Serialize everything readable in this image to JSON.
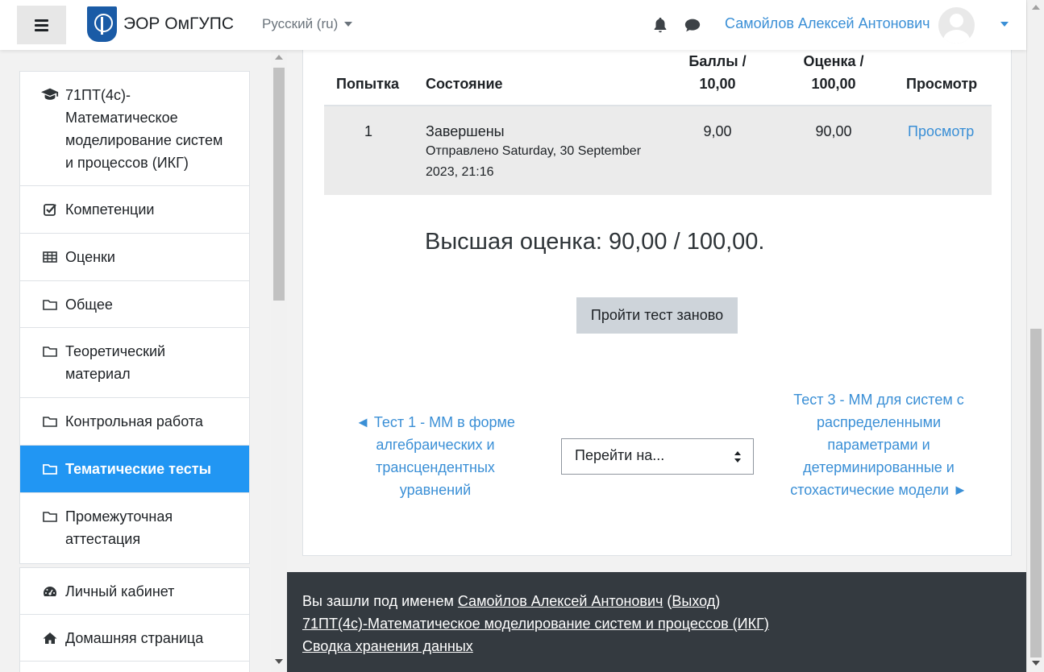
{
  "navbar": {
    "brand": "ЭОР ОмГУПС",
    "language": "Русский (ru)",
    "user_name": "Самойлов Алексей Антонович"
  },
  "drawer": {
    "course": "71ПТ(4с)-Математическое моделирование систем и процессов (ИКГ)",
    "items": [
      {
        "label": "Компетенции",
        "icon": "checkbox-icon"
      },
      {
        "label": "Оценки",
        "icon": "table-icon"
      },
      {
        "label": "Общее",
        "icon": "folder-icon"
      },
      {
        "label": "Теоретический материал",
        "icon": "folder-icon"
      },
      {
        "label": "Контрольная работа",
        "icon": "folder-icon"
      },
      {
        "label": "Тематические тесты",
        "icon": "folder-icon",
        "active": true
      },
      {
        "label": "Промежуточная аттестация",
        "icon": "folder-icon"
      }
    ],
    "secondary": [
      {
        "label": "Личный кабинет",
        "icon": "dashboard-icon"
      },
      {
        "label": "Домашняя страница",
        "icon": "home-icon"
      }
    ]
  },
  "attempts": {
    "headers": {
      "attempt": "Попытка",
      "state": "Состояние",
      "marks": "Баллы / 10,00",
      "grade": "Оценка / 100,00",
      "review": "Просмотр"
    },
    "rows": [
      {
        "attempt": "1",
        "state": "Завершены",
        "submitted": "Отправлено Saturday, 30 September 2023, 21:16",
        "marks": "9,00",
        "grade": "90,00",
        "review": "Просмотр"
      }
    ]
  },
  "summary": {
    "best_grade": "Высшая оценка: 90,00 / 100,00.",
    "retake_button": "Пройти тест заново"
  },
  "activity_nav": {
    "prev": "◄ Тест 1 - ММ в форме алгебраических и трансцендентных уравнений",
    "next": "Тест 3 - ММ для систем с распределенными параметрами и детерминированные и стохастические модели ►",
    "jump_placeholder": "Перейти на..."
  },
  "footer": {
    "logged_in_prefix": "Вы зашли под именем",
    "user_name": "Самойлов Алексей Антонович",
    "logout": "Выход",
    "course_link": "71ПТ(4с)-Математическое моделирование систем и процессов (ИКГ)",
    "data_summary": "Сводка хранения данных"
  },
  "colors": {
    "accent": "#2196f3",
    "link": "#3a8fd6",
    "footer_bg": "#343a40"
  }
}
